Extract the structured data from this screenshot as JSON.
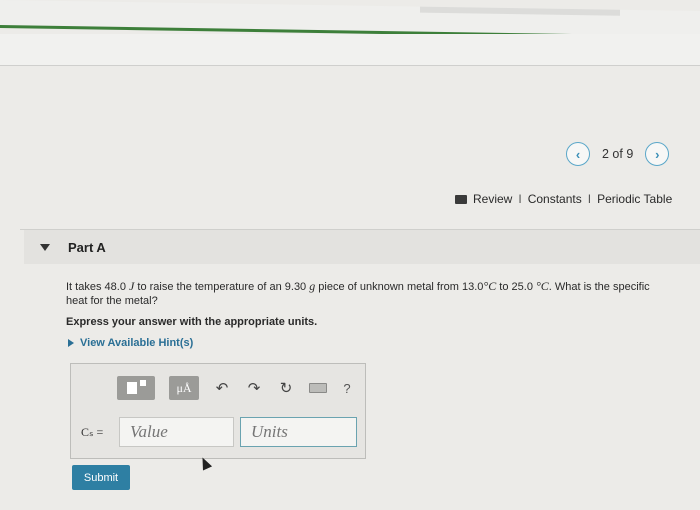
{
  "pager": {
    "prev_icon": "chevron-left-icon",
    "text": "2 of 9",
    "next_icon": "chevron-right-icon"
  },
  "references": {
    "icon": "book-icon",
    "review": "Review",
    "constants": "Constants",
    "periodic": "Periodic Table",
    "separator": "I"
  },
  "part": {
    "label": "Part A"
  },
  "question": {
    "t1": "It takes ",
    "energy": "48.0",
    "energy_unit": "J",
    "t2": " to raise the temperature of an ",
    "mass": "9.30",
    "mass_unit": "g",
    "t3": " piece of unknown metal from ",
    "t_start": "13.0",
    "deg1": "°C",
    "t4": " to ",
    "t_end": "25.0",
    "deg2": " °C",
    "t5": ". What is the specific heat for the metal?"
  },
  "instruction": "Express your answer with the appropriate units.",
  "hint": {
    "label": "View Available Hint(s)"
  },
  "toolbar": {
    "mu_label": "μÅ",
    "help_label": "?"
  },
  "answer": {
    "symbol": "Cₛ =",
    "value_placeholder": "Value",
    "units_placeholder": "Units"
  },
  "submit_label": "Submit",
  "colors": {
    "accent": "#2e7fa3",
    "green_rule": "#3d7f3a"
  }
}
